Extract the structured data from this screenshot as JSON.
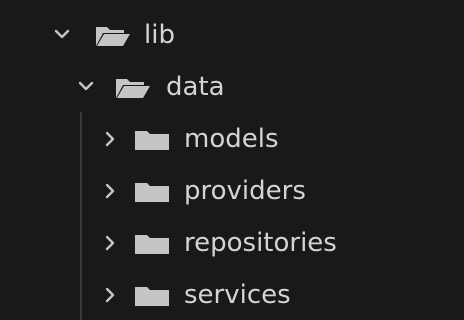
{
  "tree": {
    "lib": {
      "label": "lib",
      "icon": "folder-open-icon",
      "expanded": true
    },
    "data": {
      "label": "data",
      "icon": "folder-open-icon",
      "expanded": true
    },
    "children": [
      {
        "label": "models",
        "icon": "folder-closed-icon",
        "expanded": false
      },
      {
        "label": "providers",
        "icon": "folder-closed-icon",
        "expanded": false
      },
      {
        "label": "repositories",
        "icon": "folder-closed-icon",
        "expanded": false
      },
      {
        "label": "services",
        "icon": "folder-closed-icon",
        "expanded": false
      }
    ]
  },
  "colors": {
    "background": "#191919",
    "text": "#d4d4d4",
    "icon": "#c5c5c5",
    "indent_guide": "#3a3a3a"
  }
}
